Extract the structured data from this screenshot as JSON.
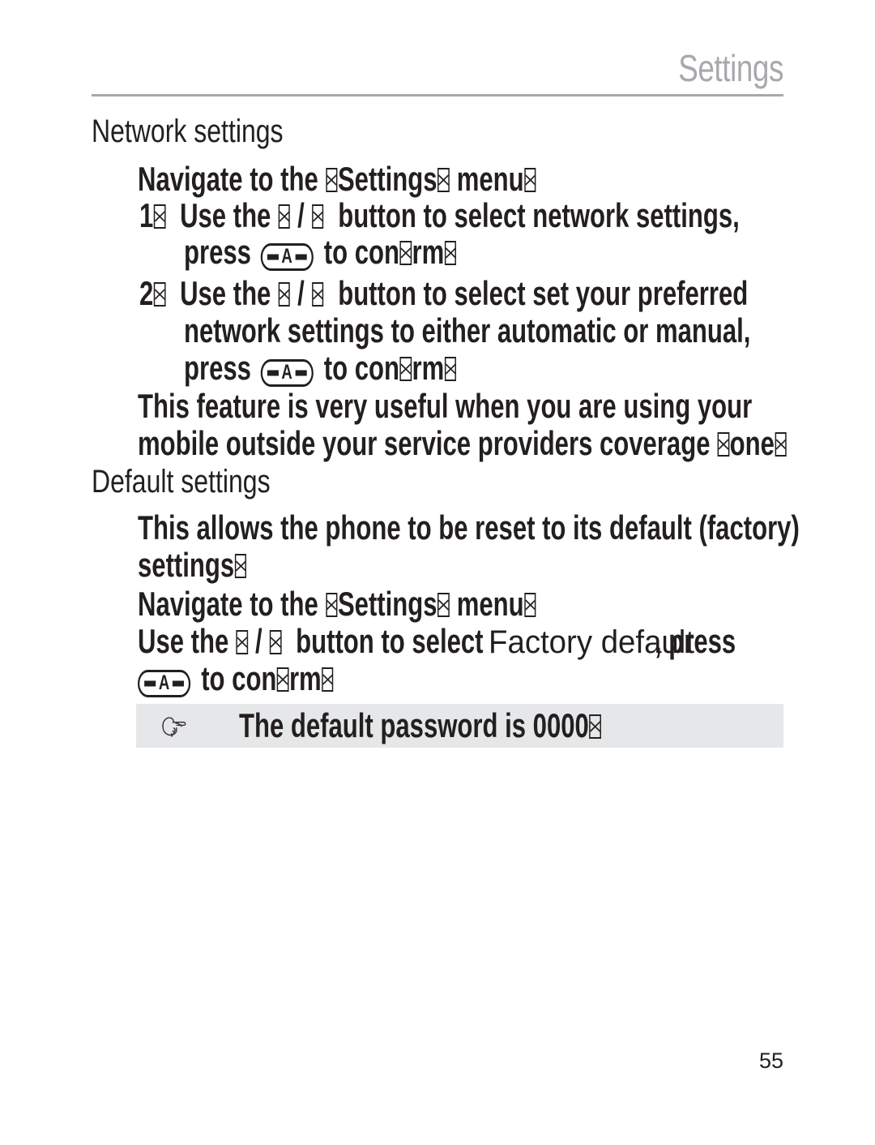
{
  "page": {
    "header_title": "Settings",
    "page_number": "55",
    "colors": {
      "header_gray": "#a7a9ac",
      "text_black": "#231f20",
      "note_bar_gray": "#e6e7e8"
    }
  },
  "sections": [
    {
      "heading": "Network settings",
      "intro": {
        "pre": "Navigate to the ",
        "menu": "Settings",
        "post": " menu"
      },
      "steps": [
        {
          "number": "1",
          "line1_a": "Use the ",
          "line1_b": " / ",
          "line1_c": " button to select network settings,",
          "line2_a": "press ",
          "line2_b": " to con",
          "line2_c": "rm"
        },
        {
          "number": "2",
          "line1_a": "Use the ",
          "line1_b": " / ",
          "line1_c": " button to select set your preferred",
          "line2": "network settings to either automatic or manual,",
          "line3_a": "press ",
          "line3_b": " to con",
          "line3_c": "rm"
        }
      ],
      "note_lines": [
        "This feature is very useful when you are using your",
        "mobile outside your service providers coverage "
      ],
      "note_tail": "one"
    },
    {
      "heading": "Default settings",
      "body_lines": [
        "This allows the phone to be reset to its default (factory)",
        "settings"
      ],
      "intro": {
        "pre": "Navigate to the ",
        "menu": "Settings",
        "post": " menu"
      },
      "instruction": {
        "a": "Use the ",
        "b": " / ",
        "c": " button to select ",
        "menu_name": "Factory default",
        "d": ", press",
        "e": " to con",
        "f": "rm"
      }
    }
  ],
  "note_bar": {
    "icon": "pointing-hand-icon",
    "text": "The default password is 0000"
  }
}
